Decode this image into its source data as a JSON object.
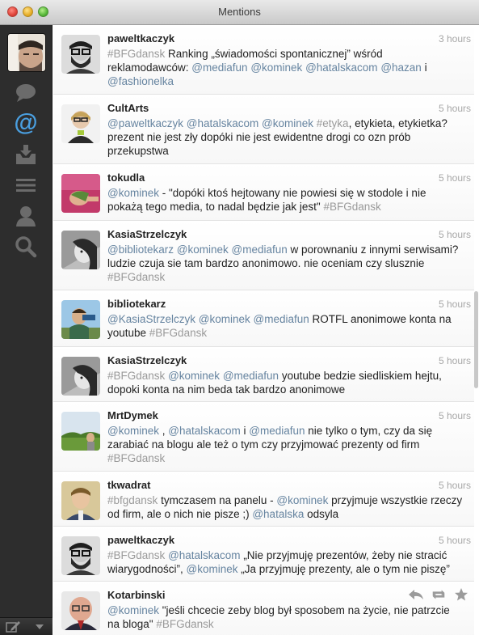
{
  "window": {
    "title": "Mentions"
  },
  "sidebar": {
    "items": [
      {
        "icon": "speech-bubble-icon"
      },
      {
        "icon": "at-sign-icon",
        "label": "@",
        "active": true
      },
      {
        "icon": "inbox-download-icon"
      },
      {
        "icon": "list-icon"
      },
      {
        "icon": "profile-icon"
      },
      {
        "icon": "search-icon"
      }
    ]
  },
  "colors": {
    "mention": "#6684a0",
    "hashtag": "#9a9a9a",
    "active_icon": "#4a9fe0",
    "sidebar": "#2d2d2d"
  },
  "tweets": [
    {
      "name": "paweltkaczyk",
      "time": "3 hours",
      "parts": [
        {
          "t": "#BFGdansk",
          "k": "h"
        },
        {
          "t": " Ranking „świadomości spontanicznej” wśród reklamodawców: "
        },
        {
          "t": "@mediafun",
          "k": "m"
        },
        {
          "t": " "
        },
        {
          "t": "@kominek",
          "k": "m"
        },
        {
          "t": " "
        },
        {
          "t": "@hatalskacom",
          "k": "m"
        },
        {
          "t": " "
        },
        {
          "t": "@hazan",
          "k": "m"
        },
        {
          "t": " i "
        },
        {
          "t": "@fashionelka",
          "k": "m"
        }
      ]
    },
    {
      "name": "CultArts",
      "time": "5 hours",
      "parts": [
        {
          "t": "@paweltkaczyk",
          "k": "m"
        },
        {
          "t": " "
        },
        {
          "t": "@hatalskacom",
          "k": "m"
        },
        {
          "t": " "
        },
        {
          "t": "@kominek",
          "k": "m"
        },
        {
          "t": " "
        },
        {
          "t": "#etyka",
          "k": "h"
        },
        {
          "t": ", etykieta, etykietka? prezent nie jest zły dopóki nie jest ewidentne drogi co ozn prób przekupstwa"
        }
      ]
    },
    {
      "name": "tokudla",
      "time": "5 hours",
      "parts": [
        {
          "t": "@kominek",
          "k": "m"
        },
        {
          "t": " - \"dopóki ktoś hejtowany nie powiesi się w stodole i nie pokażą tego media, to nadal będzie jak jest\" "
        },
        {
          "t": "#BFGdansk",
          "k": "h"
        }
      ]
    },
    {
      "name": "KasiaStrzelczyk",
      "time": "5 hours",
      "parts": [
        {
          "t": "@bibliotekarz",
          "k": "m"
        },
        {
          "t": " "
        },
        {
          "t": "@kominek",
          "k": "m"
        },
        {
          "t": " "
        },
        {
          "t": "@mediafun",
          "k": "m"
        },
        {
          "t": " w porownaniu z innymi serwisami? ludzie czuja sie tam bardzo anonimowo. nie oceniam czy slusznie "
        },
        {
          "t": "#BFGdansk",
          "k": "h"
        }
      ]
    },
    {
      "name": "bibliotekarz",
      "time": "5 hours",
      "parts": [
        {
          "t": "@KasiaStrzelczyk",
          "k": "m"
        },
        {
          "t": " "
        },
        {
          "t": "@kominek",
          "k": "m"
        },
        {
          "t": " "
        },
        {
          "t": "@mediafun",
          "k": "m"
        },
        {
          "t": " ROTFL anonimowe konta na youtube "
        },
        {
          "t": "#BFGdansk",
          "k": "h"
        }
      ]
    },
    {
      "name": "KasiaStrzelczyk",
      "time": "5 hours",
      "parts": [
        {
          "t": "#BFGdansk",
          "k": "h"
        },
        {
          "t": " "
        },
        {
          "t": "@kominek",
          "k": "m"
        },
        {
          "t": " "
        },
        {
          "t": "@mediafun",
          "k": "m"
        },
        {
          "t": " youtube bedzie siedliskiem hejtu, dopoki konta na nim beda tak bardzo anonimowe"
        }
      ]
    },
    {
      "name": "MrtDymek",
      "time": "5 hours",
      "parts": [
        {
          "t": "@kominek",
          "k": "m"
        },
        {
          "t": " , "
        },
        {
          "t": "@hatalskacom",
          "k": "m"
        },
        {
          "t": "  i "
        },
        {
          "t": "@mediafun",
          "k": "m"
        },
        {
          "t": " nie tylko o tym, czy da się zarabiać na blogu ale też o tym czy przyjmować prezenty od firm "
        },
        {
          "t": "#BFGdansk",
          "k": "h"
        }
      ]
    },
    {
      "name": "tkwadrat",
      "time": "5 hours",
      "parts": [
        {
          "t": "#bfgdansk",
          "k": "h"
        },
        {
          "t": " tymczasem na panelu - "
        },
        {
          "t": "@kominek",
          "k": "m"
        },
        {
          "t": " przyjmuje wszystkie rzeczy od firm, ale o nich nie pisze ;) "
        },
        {
          "t": "@hatalska",
          "k": "m"
        },
        {
          "t": " odsyla"
        }
      ]
    },
    {
      "name": "paweltkaczyk",
      "time": "5 hours",
      "parts": [
        {
          "t": "#BFGdansk",
          "k": "h"
        },
        {
          "t": " "
        },
        {
          "t": "@hatalskacom",
          "k": "m"
        },
        {
          "t": " „Nie przyjmuję prezentów, żeby nie stracić wiarygodności”, "
        },
        {
          "t": "@kominek",
          "k": "m"
        },
        {
          "t": " „Ja przyjmuję prezenty, ale o tym nie piszę”"
        }
      ]
    },
    {
      "name": "Kotarbinski",
      "time": "",
      "actions": [
        "reply-icon",
        "retweet-icon",
        "favorite-star-icon"
      ],
      "parts": [
        {
          "t": "@kominek",
          "k": "m"
        },
        {
          "t": " \"jeśli chcecie zeby blog był sposobem na życie, nie patrzcie na bloga\" "
        },
        {
          "t": "#BFGdansk",
          "k": "h"
        }
      ]
    }
  ]
}
